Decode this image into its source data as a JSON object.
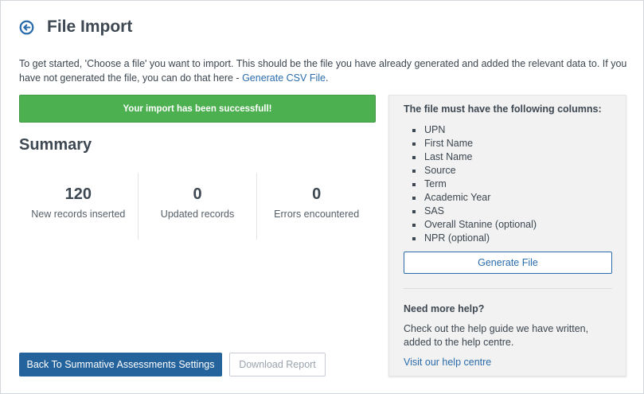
{
  "header": {
    "title": "File Import",
    "back_icon": "arrow-left-circle-icon"
  },
  "intro": {
    "text": "To get started, 'Choose a file' you want to import. This should be the file you have already generated and added the relevant data to. If you have not generated the file, you can do that here - ",
    "link": "Generate CSV File",
    "suffix": "."
  },
  "banner": {
    "message": "Your import has been successfull!",
    "color": "#4caf50"
  },
  "summary": {
    "title": "Summary",
    "stats": [
      {
        "value": "120",
        "label": "New records inserted"
      },
      {
        "value": "0",
        "label": "Updated records"
      },
      {
        "value": "0",
        "label": "Errors encountered"
      }
    ]
  },
  "actions": {
    "back_label": "Back To Summative Assessments Settings",
    "download_label": "Download Report",
    "primary_color": "#25639c"
  },
  "sidebar": {
    "heading": "The file must have the following columns:",
    "columns": [
      "UPN",
      "First Name",
      "Last Name",
      "Source",
      "Term",
      "Academic Year",
      "SAS",
      "Overall Stanine (optional)",
      "NPR (optional)"
    ],
    "generate_label": "Generate File",
    "help_title": "Need more help?",
    "help_text": "Check out the help guide we have written, added to the help centre.",
    "help_link": "Visit our help centre"
  }
}
